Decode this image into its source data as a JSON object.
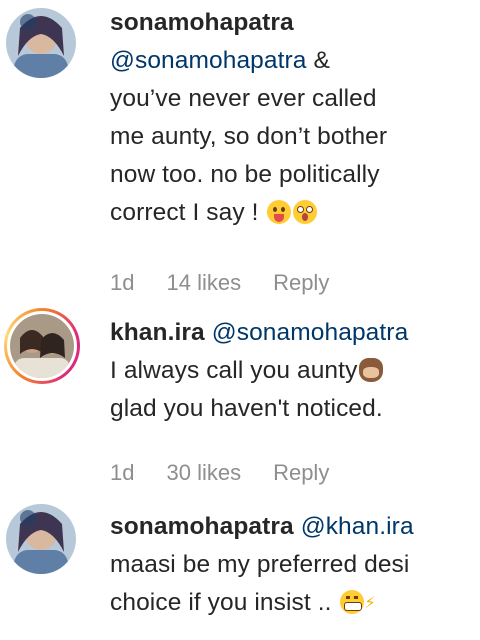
{
  "comments": [
    {
      "username": "sonamohapatra",
      "mention": "@sonamohapatra",
      "text_after_mention": " &",
      "lines": [
        "you’ve never ever called",
        "me aunty, so don’t bother",
        "now too. no be politically",
        "correct I say !"
      ],
      "emojis": [
        "tongue-out-emoji",
        "astonished-emoji"
      ],
      "time": "1d",
      "likes": "14 likes",
      "reply": "Reply"
    },
    {
      "username": "khan.ira",
      "mention": "@sonamohapatra",
      "line2": "I always call you aunty",
      "line3": "glad you haven't noticed.",
      "emojis": [
        "see-no-evil-monkey-emoji"
      ],
      "time": "1d",
      "likes": "30 likes",
      "reply": "Reply"
    },
    {
      "username": "sonamohapatra",
      "mention": "@khan.ira",
      "line2": "maasi be my preferred desi",
      "line3": "choice if you insist ..",
      "emojis": [
        "grimacing-emoji",
        "sparkle-emoji"
      ]
    }
  ],
  "colors": {
    "text": "#262626",
    "mention": "#00376b",
    "meta": "#8e8e8e",
    "story_ring": [
      "#f58529",
      "#dd2a7b",
      "#feda77"
    ]
  }
}
